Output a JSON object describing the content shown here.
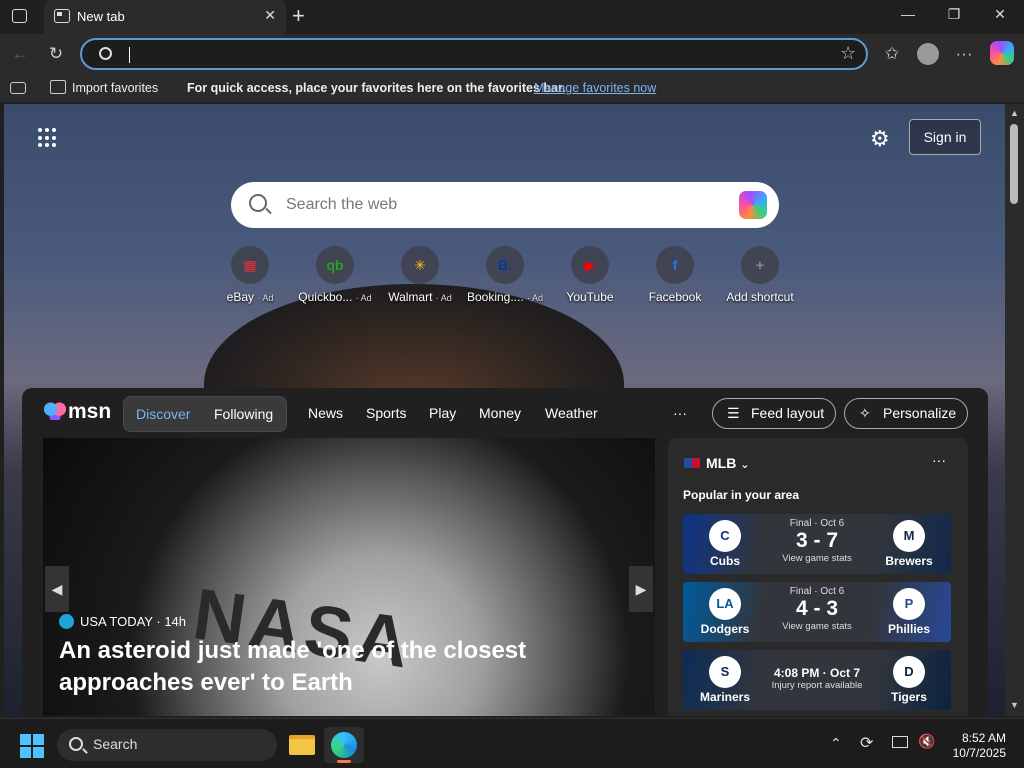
{
  "browser": {
    "tab_title": "New tab",
    "tab_close": "✕",
    "new_tab": "+",
    "window_controls": {
      "minimize": "—",
      "restore": "❐",
      "close": "✕"
    },
    "address_value": ""
  },
  "favorites_bar": {
    "import": "Import favorites",
    "message": "For quick access, place your favorites here on the favorites bar.",
    "manage_link": "Manage favorites now"
  },
  "newtab": {
    "sign_in": "Sign in",
    "search_placeholder": "Search the web",
    "shortcuts": [
      {
        "label": "eBay",
        "ad": "· Ad",
        "glyph": "▦",
        "color": "#e53238"
      },
      {
        "label": "Quickbo...",
        "ad": "· Ad",
        "glyph": "qb",
        "color": "#2ca01c"
      },
      {
        "label": "Walmart",
        "ad": "· Ad",
        "glyph": "✳",
        "color": "#ffc220"
      },
      {
        "label": "Booking....",
        "ad": "· Ad",
        "glyph": "B.",
        "color": "#003b95"
      },
      {
        "label": "YouTube",
        "ad": "",
        "glyph": "▶",
        "color": "#ff0000"
      },
      {
        "label": "Facebook",
        "ad": "",
        "glyph": "f",
        "color": "#1877f2"
      },
      {
        "label": "Add shortcut",
        "ad": "",
        "glyph": "+",
        "color": "#8a8a8a"
      }
    ]
  },
  "msn": {
    "logo": "msn",
    "tabs": {
      "discover": "Discover",
      "following": "Following"
    },
    "nav": [
      "News",
      "Sports",
      "Play",
      "Money",
      "Weather"
    ],
    "more": "···",
    "feed_layout": "Feed layout",
    "personalize": "Personalize",
    "hero": {
      "source": "USA TODAY",
      "age": "· 14h",
      "headline": "An asteroid just made 'one of the closest approaches ever' to Earth",
      "image_text": "NASA"
    },
    "sports": {
      "league": "MLB",
      "more": "···",
      "popular": "Popular in your area",
      "games": [
        {
          "home": "Cubs",
          "home_logo": "C",
          "away": "Brewers",
          "away_logo": "M",
          "status": "Final · Oct 6",
          "score": "3 - 7",
          "sub": "View game stats",
          "left_color": "#0e3386",
          "right_color": "#12284b"
        },
        {
          "home": "Dodgers",
          "home_logo": "LA",
          "away": "Phillies",
          "away_logo": "P",
          "status": "Final · Oct 6",
          "score": "4 - 3",
          "sub": "View game stats",
          "left_color": "#005a9c",
          "right_color": "#284898"
        },
        {
          "home": "Mariners",
          "home_logo": "S",
          "away": "Tigers",
          "away_logo": "D",
          "status": "4:08 PM · Oct 7",
          "score": "",
          "sub": "Injury report available",
          "left_color": "#0c2c56",
          "right_color": "#0c2340"
        }
      ]
    }
  },
  "taskbar": {
    "search": "Search",
    "time": "8:52 AM",
    "date": "10/7/2025"
  }
}
